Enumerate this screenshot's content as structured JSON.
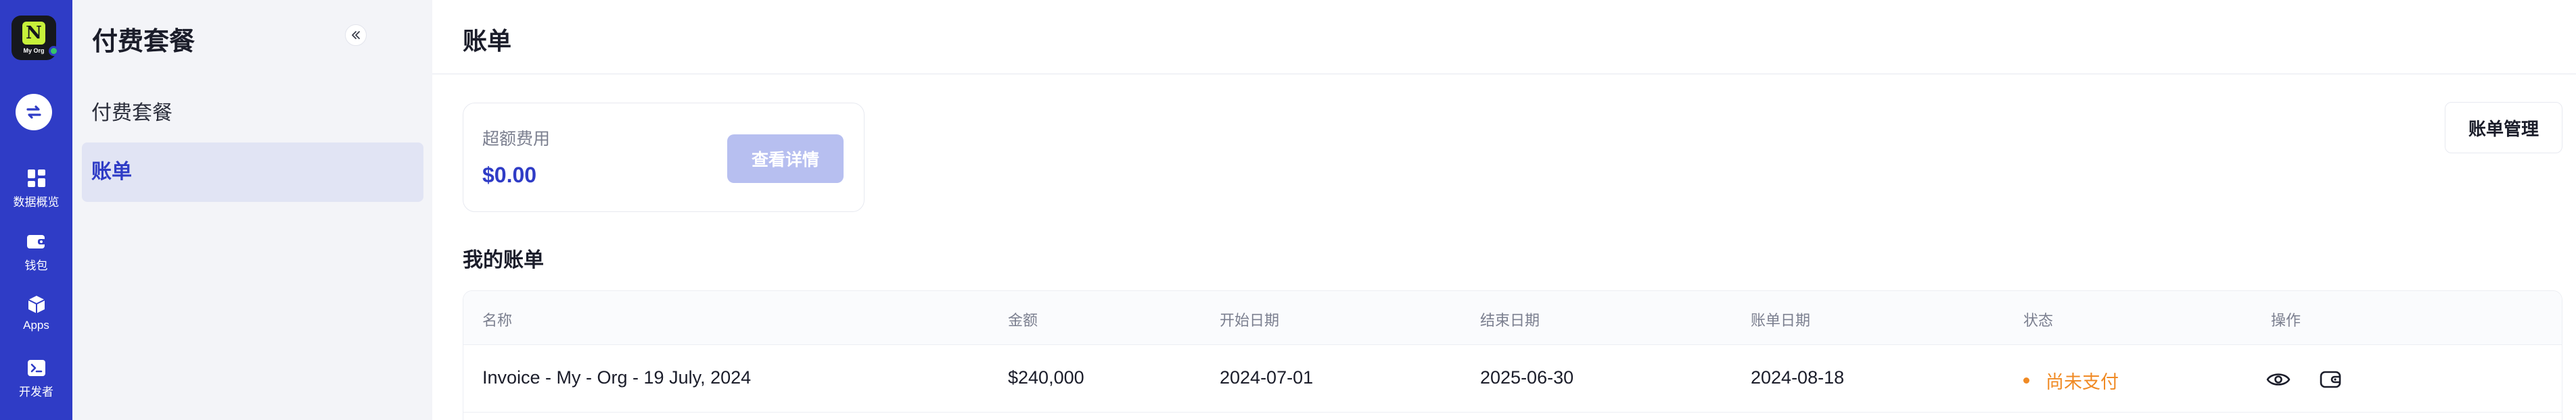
{
  "rail": {
    "org_name": "My Org",
    "items": [
      {
        "label": "数据概览",
        "icon": "dashboard-icon"
      },
      {
        "label": "钱包",
        "icon": "wallet-icon"
      },
      {
        "label": "Apps",
        "icon": "cube-icon"
      },
      {
        "label": "开发者",
        "icon": "terminal-icon"
      }
    ]
  },
  "sidebar": {
    "title": "付费套餐",
    "items": [
      {
        "label": "付费套餐",
        "active": false
      },
      {
        "label": "账单",
        "active": true
      }
    ]
  },
  "main": {
    "title": "账单",
    "overage": {
      "label": "超额费用",
      "value": "$0.00",
      "detail_button": "查看详情"
    },
    "billing_management_button": "账单管理",
    "section_title": "我的账单",
    "table": {
      "columns": [
        "名称",
        "金额",
        "开始日期",
        "结束日期",
        "账单日期",
        "状态",
        "操作"
      ],
      "rows": [
        {
          "name": "Invoice - My - Org - 19 July, 2024",
          "amount": "$240,000",
          "start_date": "2024-07-01",
          "end_date": "2025-06-30",
          "bill_date": "2024-08-18",
          "status": "尚未支付",
          "actions": [
            "view-icon",
            "wallet-icon"
          ]
        }
      ]
    }
  },
  "colors": {
    "brand": "#2f3cc6",
    "status_unpaid": "#f08a24",
    "button_disabled": "#b7bff0"
  }
}
